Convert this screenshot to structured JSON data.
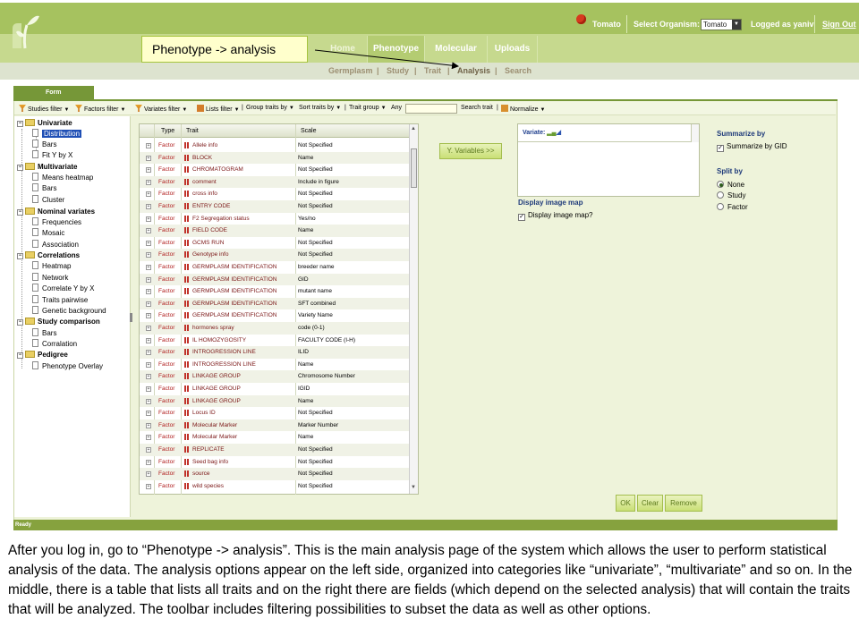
{
  "header": {
    "organism_label": "Tomato",
    "select_organism_label": "Select Organism:",
    "organism_selected": "Tomato",
    "logged_as": "Logged as yaniv",
    "sign_out": "Sign Out"
  },
  "nav": {
    "tabs": [
      {
        "label": "Home"
      },
      {
        "label": "Phenotype"
      },
      {
        "label": "Molecular"
      },
      {
        "label": "Uploads"
      }
    ],
    "subtabs": [
      {
        "label": "Germplasm"
      },
      {
        "label": "Study"
      },
      {
        "label": "Trait"
      },
      {
        "label": "Analysis"
      },
      {
        "label": "Search"
      }
    ]
  },
  "callout": "Phenotype -> analysis",
  "form_tab": "Form",
  "toolbar": {
    "studies_filter": "Studies filter",
    "factors_filter": "Factors filter",
    "variates_filter": "Variates filter",
    "lists_filter": "Lists filter",
    "group_traits_by": "Group traits by",
    "sort_traits_by": "Sort traits by",
    "trait_group": "Trait group",
    "any": "Any",
    "search_trait": "Search trait",
    "normalize": "Normalize"
  },
  "tree": {
    "univariate": "Univariate",
    "distribution": "Distribution",
    "bars": "Bars",
    "fit_y_by_x": "Fit Y by X",
    "multivariate": "Multivariate",
    "means_heatmap": "Means heatmap",
    "bars2": "Bars",
    "cluster": "Cluster",
    "nominal_variates": "Nominal variates",
    "frequencies": "Frequencies",
    "mosaic": "Mosaic",
    "association": "Association",
    "correlations": "Correlations",
    "heatmap": "Heatmap",
    "network": "Network",
    "correlate_y_by_x": "Correlate Y by X",
    "traits_pairwise": "Traits pairwise",
    "genetic_background": "Genetic background",
    "study_comparison": "Study comparison",
    "bars3": "Bars",
    "corralation": "Corralation",
    "pedigree": "Pedigree",
    "phenotype_overlay": "Phenotype Overlay"
  },
  "table": {
    "columns": {
      "type": "Type",
      "trait": "Trait",
      "scale": "Scale"
    },
    "rows": [
      {
        "type": "Factor",
        "trait": "Allele info",
        "scale": "Not Specified"
      },
      {
        "type": "Factor",
        "trait": "BLOCK",
        "scale": "Name"
      },
      {
        "type": "Factor",
        "trait": "CHROMATOGRAM",
        "scale": "Not Specified"
      },
      {
        "type": "Factor",
        "trait": "comment",
        "scale": "Include in figure"
      },
      {
        "type": "Factor",
        "trait": "cross info",
        "scale": "Not Specified"
      },
      {
        "type": "Factor",
        "trait": "ENTRY CODE",
        "scale": "Not Specified"
      },
      {
        "type": "Factor",
        "trait": "F2 Segregation status",
        "scale": "Yes/no"
      },
      {
        "type": "Factor",
        "trait": "FIELD CODE",
        "scale": "Name"
      },
      {
        "type": "Factor",
        "trait": "GCMS RUN",
        "scale": "Not Specified"
      },
      {
        "type": "Factor",
        "trait": "Genotype info",
        "scale": "Not Specified"
      },
      {
        "type": "Factor",
        "trait": "GERMPLASM IDENTIFICATION",
        "scale": "breeder name"
      },
      {
        "type": "Factor",
        "trait": "GERMPLASM IDENTIFICATION",
        "scale": "GID"
      },
      {
        "type": "Factor",
        "trait": "GERMPLASM IDENTIFICATION",
        "scale": "mutant name"
      },
      {
        "type": "Factor",
        "trait": "GERMPLASM IDENTIFICATION",
        "scale": "SFT combined"
      },
      {
        "type": "Factor",
        "trait": "GERMPLASM IDENTIFICATION",
        "scale": "Variety Name"
      },
      {
        "type": "Factor",
        "trait": "hormones spray",
        "scale": "code (0-1)"
      },
      {
        "type": "Factor",
        "trait": "IL HOMOZYGOSITY",
        "scale": "FACULTY CODE (I-H)"
      },
      {
        "type": "Factor",
        "trait": "INTROGRESSION LINE",
        "scale": "ILID"
      },
      {
        "type": "Factor",
        "trait": "INTROGRESSION LINE",
        "scale": "Name"
      },
      {
        "type": "Factor",
        "trait": "LINKAGE GROUP",
        "scale": "Chromosome Number"
      },
      {
        "type": "Factor",
        "trait": "LINKAGE GROUP",
        "scale": "IGID"
      },
      {
        "type": "Factor",
        "trait": "LINKAGE GROUP",
        "scale": "Name"
      },
      {
        "type": "Factor",
        "trait": "Locus ID",
        "scale": "Not Specified"
      },
      {
        "type": "Factor",
        "trait": "Molecular Marker",
        "scale": "Marker Number"
      },
      {
        "type": "Factor",
        "trait": "Molecular Marker",
        "scale": "Name"
      },
      {
        "type": "Factor",
        "trait": "REPLICATE",
        "scale": "Not Specified"
      },
      {
        "type": "Factor",
        "trait": "Seed bag info",
        "scale": "Not Specified"
      },
      {
        "type": "Factor",
        "trait": "source",
        "scale": "Not Specified"
      },
      {
        "type": "Factor",
        "trait": "wild species",
        "scale": "Not Specified"
      }
    ]
  },
  "right": {
    "y_variables_button": "Y. Variables >>",
    "variate_label": "Variate:",
    "display_image_map_title": "Display image map",
    "display_image_map_check": "Display image map?",
    "summarize_by_title": "Summarize by",
    "summarize_by_gid": "Summarize by GID",
    "split_by_title": "Split by",
    "split_options": [
      "None",
      "Study",
      "Factor"
    ]
  },
  "buttons": {
    "ok": "OK",
    "clear": "Clear",
    "remove": "Remove"
  },
  "status": "Ready",
  "description": "After you log in, go to “Phenotype -> analysis”. This is the main analysis page of the system which allows the user to perform statistical analysis of the data. The analysis options appear on the left side, organized into categories like “univariate”, “multivariate” and so on. In the middle, there is a table that lists all traits and on the right there are fields (which depend on the selected analysis) that will contain the traits that will be analyzed. The toolbar includes filtering possibilities to subset the data as well as other options."
}
